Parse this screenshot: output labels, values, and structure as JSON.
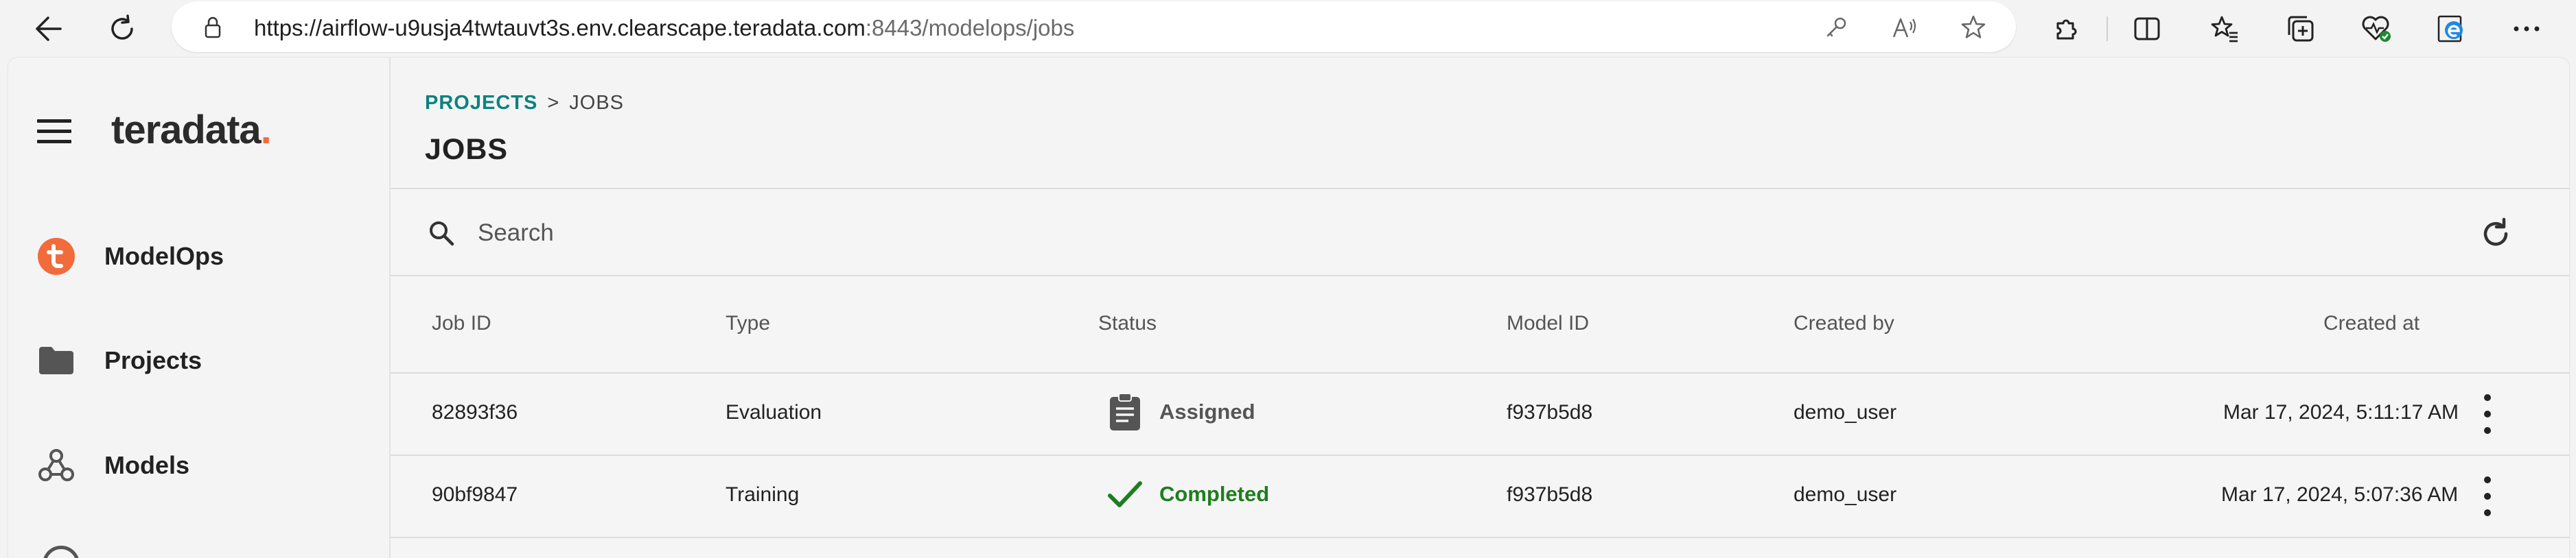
{
  "browser": {
    "url_main": "https://airflow-u9usja4twtauvt3s.env.clearscape.teradata.com",
    "url_rest": ":8443/modelops/jobs",
    "icons": [
      "back-icon",
      "reload-icon",
      "lock-icon",
      "key-icon",
      "read-aloud-icon",
      "favorite-star-icon",
      "extensions-icon",
      "split-screen-icon",
      "favorites-icon",
      "collections-icon",
      "health-icon",
      "edge-icon",
      "more-icon"
    ]
  },
  "sidebar": {
    "logo_text": "teradata",
    "logo_dot": ".",
    "items": [
      {
        "label": "ModelOps",
        "icon": "teradata-t-icon"
      },
      {
        "label": "Projects",
        "icon": "folder-icon"
      },
      {
        "label": "Models",
        "icon": "models-icon"
      }
    ]
  },
  "breadcrumb": {
    "link": "PROJECTS",
    "separator": ">",
    "current": "JOBS"
  },
  "page_title": "JOBS",
  "search": {
    "placeholder": "Search"
  },
  "table": {
    "headers": [
      "Job ID",
      "Type",
      "Status",
      "Model ID",
      "Created by",
      "Created at"
    ],
    "rows": [
      {
        "job_id": "82893f36",
        "type": "Evaluation",
        "status": "Assigned",
        "status_icon": "clipboard-icon",
        "status_color": "#555555",
        "model_id": "f937b5d8",
        "created_by": "demo_user",
        "created_at": "Mar 17, 2024, 5:11:17 AM"
      },
      {
        "job_id": "90bf9847",
        "type": "Training",
        "status": "Completed",
        "status_icon": "checkmark-icon",
        "status_color": "#1e7e1e",
        "model_id": "f937b5d8",
        "created_by": "demo_user",
        "created_at": "Mar 17, 2024, 5:07:36 AM"
      }
    ]
  },
  "colors": {
    "accent": "#0b8280",
    "brand_orange": "#f26b3a",
    "completed": "#1e7e1e"
  }
}
